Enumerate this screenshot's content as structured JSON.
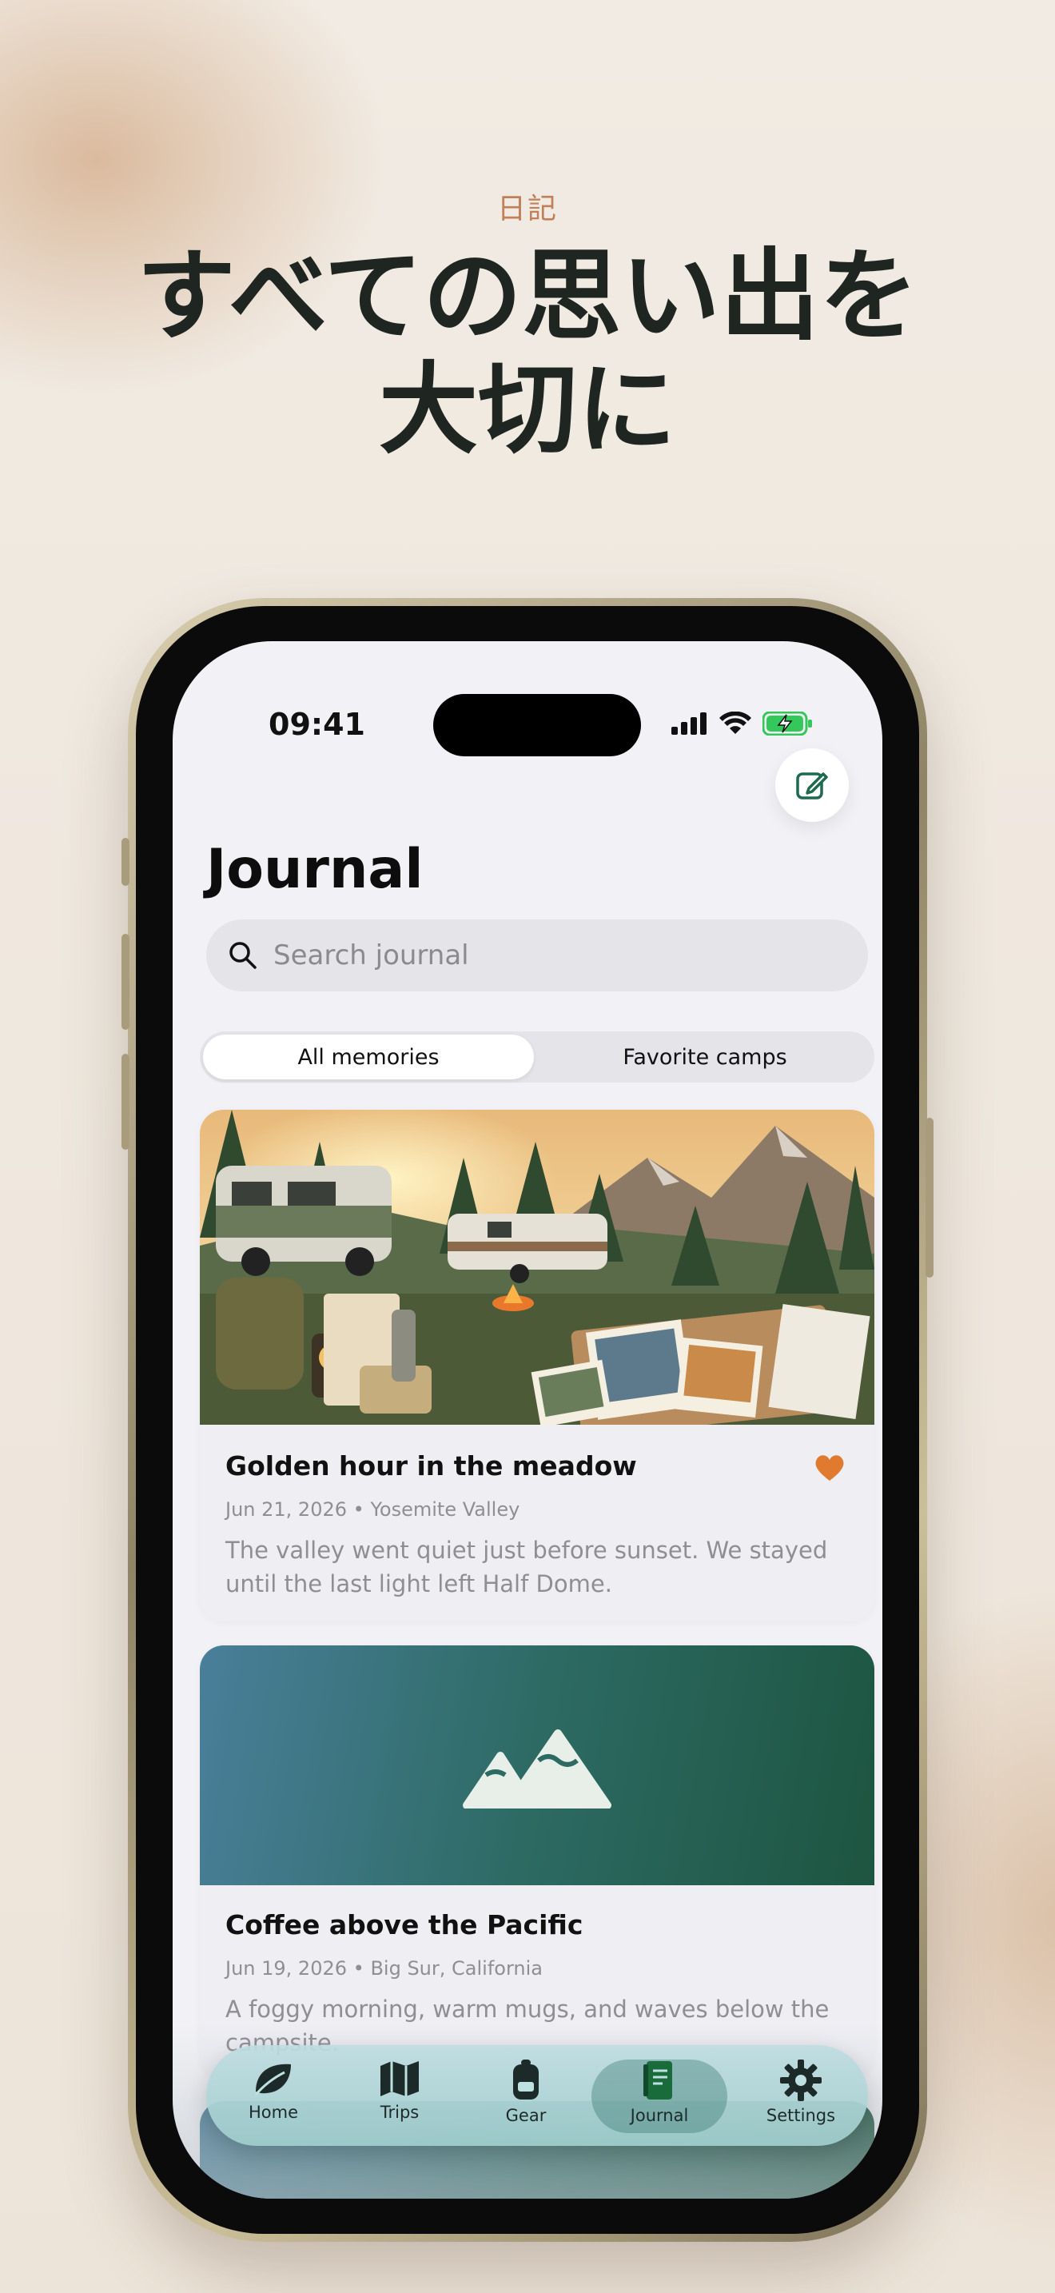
{
  "marketing": {
    "eyebrow": "日記",
    "headline_line1": "すべての思い出を",
    "headline_line2": "大切に"
  },
  "status_bar": {
    "time": "09:41",
    "battery_color": "#34c759"
  },
  "header": {
    "title": "Journal",
    "compose_icon": "compose-icon"
  },
  "search": {
    "placeholder": "Search journal"
  },
  "segments": [
    {
      "label": "All memories",
      "selected": true
    },
    {
      "label": "Favorite camps",
      "selected": false
    }
  ],
  "entries": [
    {
      "title": "Golden hour in the meadow",
      "date": "Jun 21, 2026",
      "location": "Yosemite Valley",
      "excerpt": "The valley went quiet just before sunset. We stayed until the last light left Half Dome.",
      "favorite": true,
      "image": "campsite-photo"
    },
    {
      "title": "Coffee above the Pacific",
      "date": "Jun 19, 2026",
      "location": "Big Sur, California",
      "excerpt": "A foggy morning, warm mugs, and waves below the campsite.",
      "favorite": false,
      "image": "mountain-placeholder"
    }
  ],
  "tabbar": {
    "items": [
      {
        "label": "Home",
        "icon": "leaf-icon"
      },
      {
        "label": "Trips",
        "icon": "map-icon"
      },
      {
        "label": "Gear",
        "icon": "backpack-icon"
      },
      {
        "label": "Journal",
        "icon": "journal-icon",
        "active": true
      },
      {
        "label": "Settings",
        "icon": "gear-icon"
      }
    ]
  },
  "colors": {
    "accent": "#c0805a",
    "favorite": "#e07a2e",
    "brand_green": "#1d6a4e",
    "headline": "#1f2622"
  }
}
